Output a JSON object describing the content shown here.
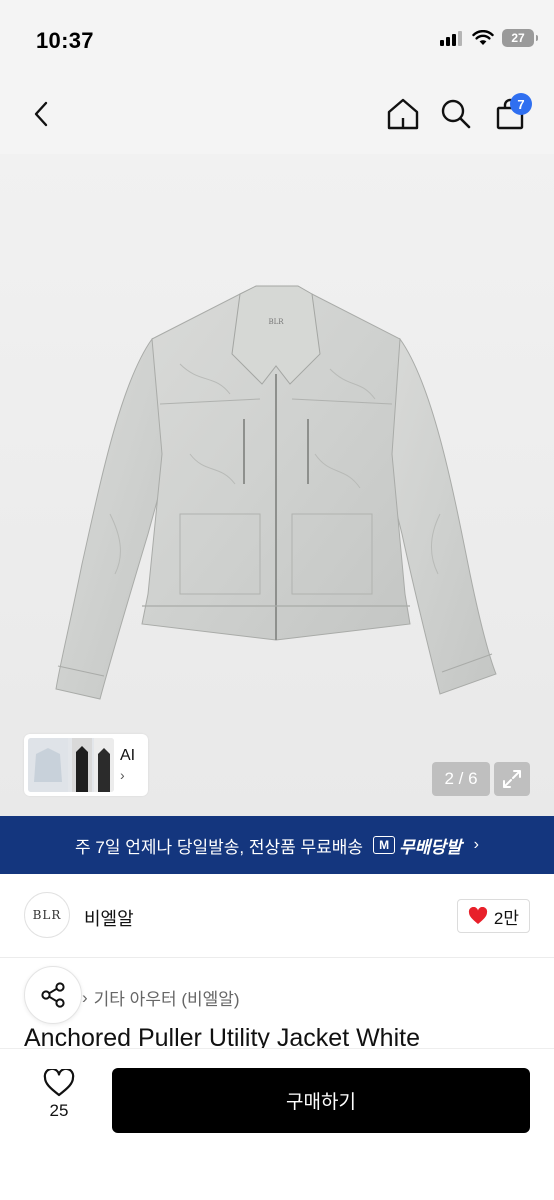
{
  "status_bar": {
    "time": "10:37",
    "battery": "27"
  },
  "nav": {
    "cart_count": "7"
  },
  "gallery": {
    "thumbnail_label": "AI",
    "thumbnail_chevron": "›",
    "page_indicator": "2 / 6",
    "jacket_label": "BLR"
  },
  "promo": {
    "text": "주 7일 언제나 당일발송, 전상품 무료배송",
    "logo_mark": "M",
    "logo_text": "무배당발",
    "chevron": "›"
  },
  "store": {
    "logo_text": "BLR",
    "name": "비엘알",
    "like_count": "2만"
  },
  "product": {
    "category_chevron": "›",
    "category": "기타 아우터 (비엘알)",
    "title": "Anchored Puller Utility Jacket White"
  },
  "bottom_bar": {
    "wish_count": "25",
    "buy_label": "구매하기"
  },
  "colors": {
    "promo_banner": "#14367e",
    "cart_badge": "#2f6ff0",
    "like_heart": "#e8202a",
    "buy_button": "#000000"
  },
  "icons": [
    "back-chevron-icon",
    "home-icon",
    "search-icon",
    "shopping-bag-icon",
    "expand-icon",
    "heart-icon",
    "share-icon"
  ]
}
